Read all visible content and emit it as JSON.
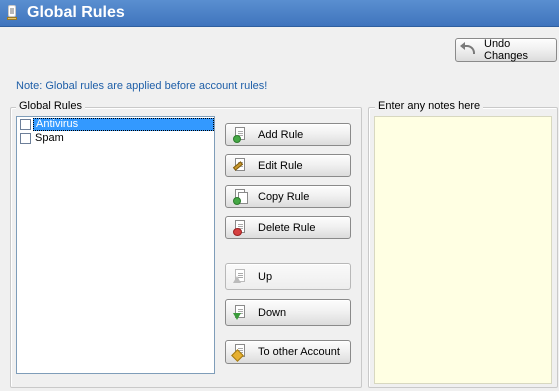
{
  "window": {
    "title": "Global Rules"
  },
  "toolbar": {
    "undo_label": "Undo Changes"
  },
  "note": "Note: Global rules are applied before account rules!",
  "rules_group": {
    "title": "Global Rules",
    "items": [
      {
        "label": "Antivirus",
        "checked": false,
        "selected": true
      },
      {
        "label": "Spam",
        "checked": false,
        "selected": false
      }
    ]
  },
  "actions": {
    "add": "Add Rule",
    "edit": "Edit Rule",
    "copy": "Copy Rule",
    "delete": "Delete Rule",
    "up": "Up",
    "down": "Down",
    "to_other_account": "To other Account"
  },
  "notes_group": {
    "title": "Enter any notes here",
    "value": ""
  },
  "colors": {
    "titlebar": "#4a82c8",
    "note_text": "#1f5fa8",
    "selection": "#3399ff",
    "notes_background": "#ffffe3"
  }
}
